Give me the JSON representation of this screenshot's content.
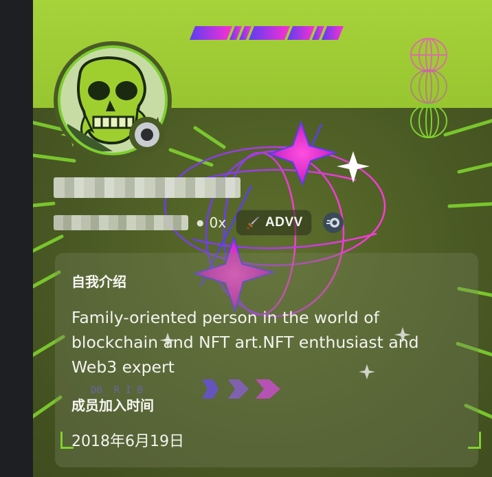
{
  "profile": {
    "handle_suffix": "0x",
    "tag": {
      "label": "ADVV",
      "icon": "sword-icon"
    },
    "badge": {
      "icon": "nitro-badge-icon"
    },
    "status": "offline"
  },
  "about": {
    "title": "自我介绍",
    "bio": "Family-oriented person in the world of blockchain and NFT art.NFT enthusiast and Web3 expert"
  },
  "member_since": {
    "title": "成员加入时间",
    "date": "2018年6月19日"
  },
  "decor": {
    "text": "D0_ R I B",
    "accent_green": "#7fd22f",
    "accent_magenta": "#ff2fd0",
    "accent_violet": "#5b3df5"
  }
}
